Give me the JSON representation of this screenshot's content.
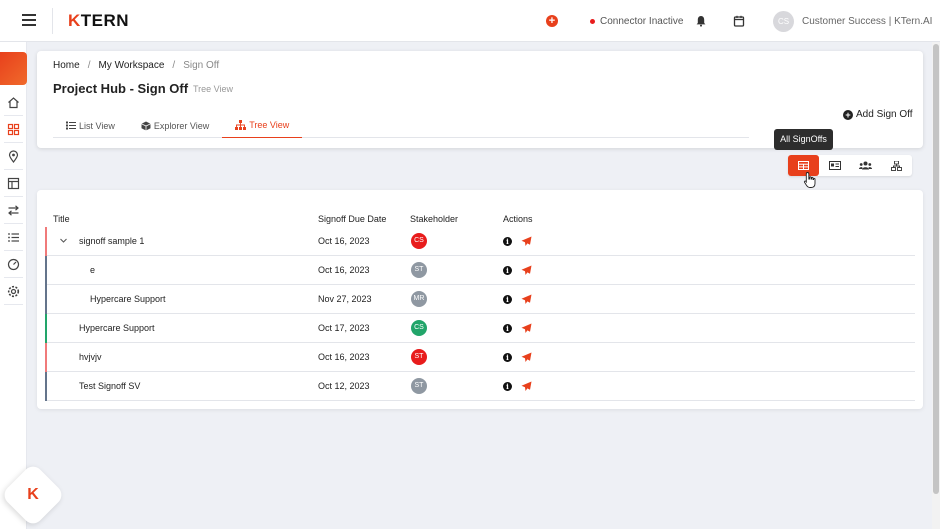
{
  "topbar": {
    "logo_k": "K",
    "logo_rest": "TERN",
    "connector_status": "Connector Inactive",
    "user_initials": "CS",
    "user_name": "Customer Success | KTern.AI"
  },
  "breadcrumb": [
    "Home",
    "My Workspace",
    "Sign Off"
  ],
  "page": {
    "title": "Project Hub - Sign Off",
    "subtitle": "Tree View"
  },
  "tabs": [
    {
      "label": "List View",
      "icon": "list-icon"
    },
    {
      "label": "Explorer View",
      "icon": "cube-icon"
    },
    {
      "label": "Tree View",
      "icon": "sitemap-icon",
      "active": true
    }
  ],
  "add_signoff_label": "Add Sign Off",
  "tooltip": "All SignOffs",
  "view_switch": [
    {
      "name": "all-signoffs",
      "icon": "table-icon",
      "active": true
    },
    {
      "name": "card-view",
      "icon": "id-card-icon"
    },
    {
      "name": "stakeholder-view",
      "icon": "users-icon"
    },
    {
      "name": "hierarchy-view",
      "icon": "sitemap-icon"
    }
  ],
  "table": {
    "headers": {
      "title": "Title",
      "due": "Signoff Due Date",
      "stakeholder": "Stakeholder",
      "actions": "Actions"
    },
    "rows": [
      {
        "title": "signoff sample 1",
        "date": "Oct 16, 2023",
        "initials": "CS",
        "badge_color": "#e81c1c",
        "bar_color": "#f07a7a",
        "level": 0,
        "expandable": true
      },
      {
        "title": "e",
        "date": "Oct 16, 2023",
        "initials": "ST",
        "badge_color": "#8f98a2",
        "bar_color": "#64748b",
        "level": 1
      },
      {
        "title": "Hypercare Support",
        "date": "Nov 27, 2023",
        "initials": "MR",
        "badge_color": "#8f98a2",
        "bar_color": "#64748b",
        "level": 2
      },
      {
        "title": "Hypercare Support",
        "date": "Oct 17, 2023",
        "initials": "CS",
        "badge_color": "#22a56a",
        "bar_color": "#22a56a",
        "level": 0
      },
      {
        "title": "hvjvjv",
        "date": "Oct 16, 2023",
        "initials": "ST",
        "badge_color": "#e81c1c",
        "bar_color": "#f07a7a",
        "level": 0
      },
      {
        "title": "Test Signoff SV",
        "date": "Oct 12, 2023",
        "initials": "ST",
        "badge_color": "#8f98a2",
        "bar_color": "#64748b",
        "level": 0
      }
    ]
  },
  "colors": {
    "accent": "#e8401c"
  }
}
